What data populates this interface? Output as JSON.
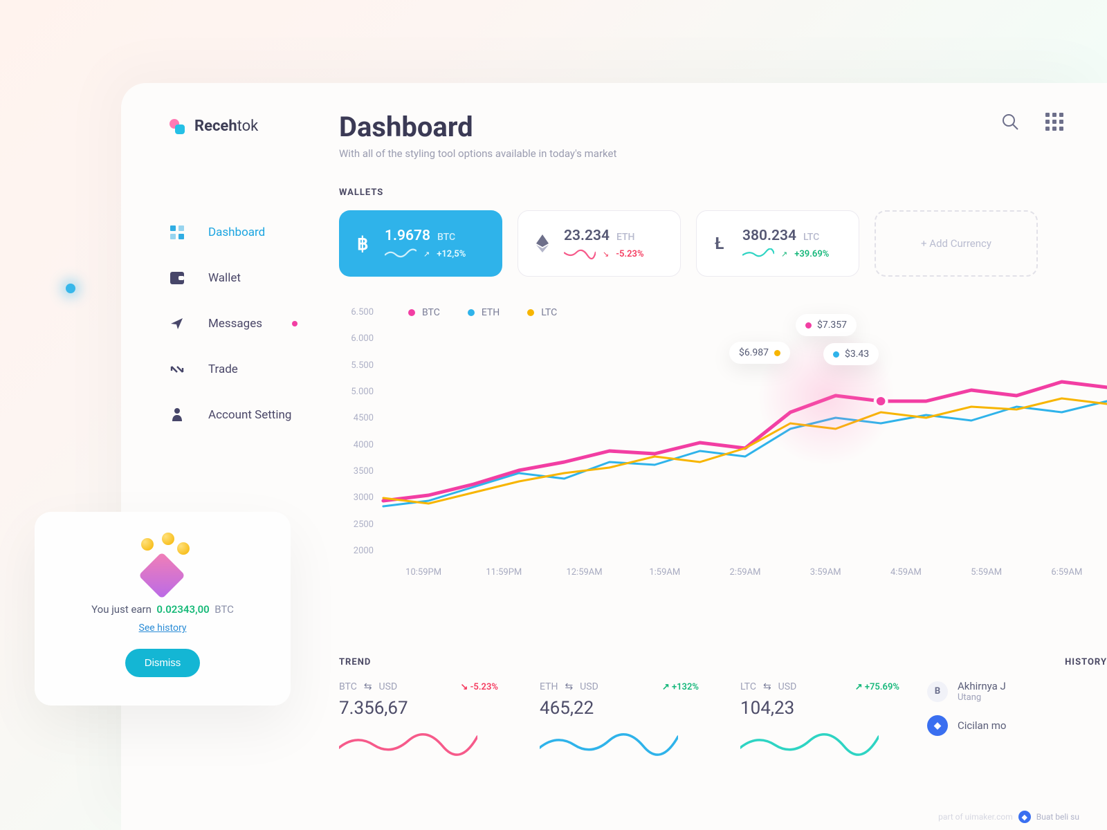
{
  "brand": {
    "bold": "Receh",
    "light": "tok"
  },
  "nav": {
    "items": [
      {
        "label": "Dashboard"
      },
      {
        "label": "Wallet"
      },
      {
        "label": "Messages"
      },
      {
        "label": "Trade"
      },
      {
        "label": "Account Setting"
      }
    ]
  },
  "header": {
    "title": "Dashboard",
    "subtitle": "With all of the styling tool options available in today's market"
  },
  "wallets_label": "WALLETS",
  "wallets": [
    {
      "amount": "1.9678",
      "currency": "BTC",
      "delta": "+12,5%",
      "dir": "up"
    },
    {
      "amount": "23.234",
      "currency": "ETH",
      "delta": "-5.23%",
      "dir": "down"
    },
    {
      "amount": "380.234",
      "currency": "LTC",
      "delta": "+39.69%",
      "dir": "up"
    }
  ],
  "add_currency": "+ Add Currency",
  "chart_legend": {
    "btc": "BTC",
    "eth": "ETH",
    "ltc": "LTC"
  },
  "chart_tips": {
    "ltc": "$6.987",
    "btc": "$7.357",
    "eth": "$3.43"
  },
  "chart_data": {
    "type": "line",
    "ylabel": "",
    "ylim": [
      2000,
      6500
    ],
    "y_ticks": [
      "6.500",
      "6.000",
      "5.500",
      "5.000",
      "4500",
      "4000",
      "3500",
      "3000",
      "2500",
      "2000"
    ],
    "x_ticks": [
      "10:59PM",
      "11:59PM",
      "12:59AM",
      "1:59AM",
      "2:59AM",
      "3:59AM",
      "4:59AM",
      "5:59AM",
      "6:59AM"
    ],
    "series": [
      {
        "name": "BTC",
        "color": "#f23ea3",
        "values": [
          3000,
          3100,
          3300,
          3550,
          3700,
          3900,
          3850,
          4050,
          3950,
          4600,
          4900,
          4800,
          4800,
          5000,
          4900,
          5150,
          5050
        ]
      },
      {
        "name": "ETH",
        "color": "#2fb3ea",
        "values": [
          2900,
          3000,
          3250,
          3500,
          3400,
          3700,
          3650,
          3900,
          3800,
          4300,
          4500,
          4400,
          4550,
          4450,
          4700,
          4600,
          4800
        ]
      },
      {
        "name": "LTC",
        "color": "#f7b500",
        "values": [
          3050,
          2950,
          3150,
          3350,
          3500,
          3600,
          3800,
          3700,
          3950,
          4400,
          4300,
          4600,
          4500,
          4700,
          4650,
          4850,
          4750
        ]
      }
    ]
  },
  "trend_label": "TREND",
  "trends": [
    {
      "from": "BTC",
      "to": "USD",
      "delta": "-5.23%",
      "dir": "down",
      "value": "7.356,67"
    },
    {
      "from": "ETH",
      "to": "USD",
      "delta": "+132%",
      "dir": "up",
      "value": "465,22"
    },
    {
      "from": "LTC",
      "to": "USD",
      "delta": "+75.69%",
      "dir": "up",
      "value": "104,23"
    }
  ],
  "history_label": "HISTORY",
  "history": [
    {
      "badge": "B",
      "text": "Akhirnya J",
      "sub": "Utang"
    },
    {
      "badge": "◆",
      "text": "Cicilan mo"
    }
  ],
  "toast": {
    "prefix": "You just earn",
    "amount": "0.02343,00",
    "currency": "BTC",
    "link": "See history",
    "button": "Dismiss"
  },
  "credit": {
    "site": "part of uimaker.com",
    "text": "Buat beli su"
  }
}
